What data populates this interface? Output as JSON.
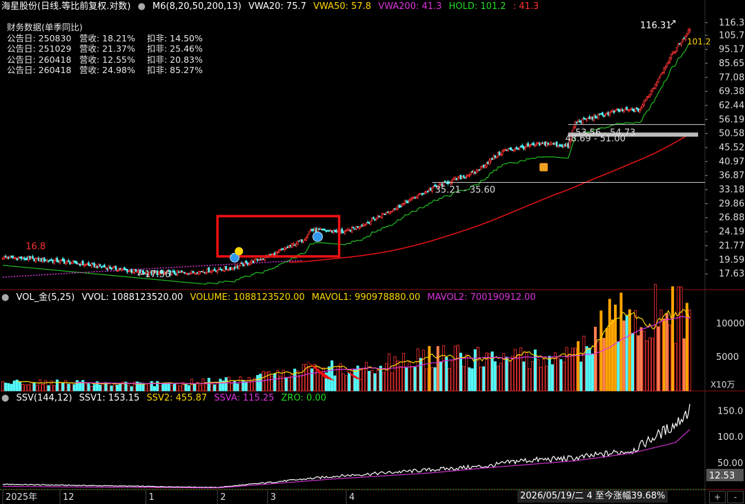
{
  "header": {
    "stock_name": "海星股份(日线.等比前复权.对数)",
    "indicator": "M6(8,20,50,200,13)",
    "vwa20": "VWA20: 75.7",
    "vwa50": "VWA50: 57.8",
    "vwa200": "VWA200: 41.3",
    "hold_label": "HOLD: 101.2",
    "hold_value": ": 41.3"
  },
  "financials": {
    "title": "财务数据(单季同比)",
    "rows": [
      {
        "date": "公告日: 250830",
        "rev": "营收: 18.21%",
        "np": "扣非: 14.50%"
      },
      {
        "date": "公告日: 251029",
        "rev": "营收: 21.37%",
        "np": "扣非: 25.46%"
      },
      {
        "date": "公告日: 260418",
        "rev": "营收: 12.55%",
        "np": "扣非: 20.83%"
      },
      {
        "date": "公告日: 260418",
        "rev": "营收: 24.98%",
        "np": "扣非: 85.27%"
      }
    ]
  },
  "vol_header": {
    "name": "VOL_金(5,25)",
    "vvol": "VVOL: 1088123520.00",
    "volume": "VOLUME: 1088123520.00",
    "mavol1": "MAVOL1: 990978880.00",
    "mavol2": "MAVOL2: 700190912.00"
  },
  "ssv_header": {
    "name": "SSV(144,12)",
    "ssv1": "SSV1: 153.15",
    "ssv2": "SSV2: 455.87",
    "ssva": "SSVA: 115.25",
    "zro": "ZRO: 0.00"
  },
  "annotations": {
    "high": "16.8",
    "low": "17.56",
    "peak": "116.31",
    "hold_line": "101.2",
    "zone1": "35.21 - 35.60",
    "zone2": "53.56 - 54.73",
    "zone3": "48.69 - 51.00",
    "ssv_current": "12.53"
  },
  "status_bar": {
    "selection": "2026/05/19/二 4 至今涨幅39.68%",
    "plus": "+",
    "minus": "-"
  },
  "colors": {
    "up": "#ff3333",
    "down": "#54fcfc",
    "hold_line": "#22bb22",
    "vwa200": "#dd1111",
    "dotted": "#cc33cc",
    "mavol1": "#ffd700",
    "mavol2": "#dd33dd",
    "ssv1": "#ffffff",
    "ssva": "#cc33cc",
    "box": "#ee1111"
  },
  "chart_data": [
    {
      "type": "candlestick",
      "title": "海星股份(日线.等比前复权.对数)",
      "yscale": "log",
      "ylim": [
        16.5,
        118
      ],
      "y_ticks": [
        "116.3",
        "105.7",
        "95.17",
        "85.65",
        "77.08",
        "69.38",
        "62.44",
        "56.19",
        "50.58",
        "45.52",
        "40.97",
        "36.87",
        "33.18",
        "29.86",
        "26.88",
        "24.19",
        "21.77",
        "19.59",
        "17.63"
      ],
      "x_labels": [
        "2025年",
        "12",
        "1",
        "2",
        "3",
        "4"
      ],
      "close_path": [
        [
          0,
          20.0
        ],
        [
          40,
          19.4
        ],
        [
          70,
          18.6
        ],
        [
          100,
          17.7
        ],
        [
          130,
          17.8
        ],
        [
          160,
          18.4
        ],
        [
          190,
          20.4
        ],
        [
          210,
          22.8
        ],
        [
          215,
          24.5
        ],
        [
          240,
          24.2
        ],
        [
          255,
          26.0
        ],
        [
          275,
          29.0
        ],
        [
          300,
          33.5
        ],
        [
          330,
          37.8
        ],
        [
          350,
          44.5
        ],
        [
          380,
          47.0
        ],
        [
          395,
          46.0
        ],
        [
          400,
          55.0
        ],
        [
          430,
          60.0
        ],
        [
          445,
          60.5
        ],
        [
          455,
          72.0
        ],
        [
          470,
          95.0
        ],
        [
          480,
          110.0
        ]
      ],
      "annotations": [
        "16.8",
        "17.56",
        "116.31",
        "101.2",
        "35.21 - 35.60",
        "53.56 - 54.73",
        "48.69 - 51.00"
      ]
    },
    {
      "type": "bar",
      "title": "VOL_金(5,25)",
      "ylim": [
        0,
        12500
      ],
      "y_ticks": [
        "10000",
        "5000"
      ],
      "unit": "X10万",
      "volume_path": [
        [
          0,
          1300
        ],
        [
          100,
          1000
        ],
        [
          170,
          1600
        ],
        [
          205,
          3200
        ],
        [
          260,
          3600
        ],
        [
          300,
          5000
        ],
        [
          350,
          4800
        ],
        [
          400,
          5200
        ],
        [
          430,
          11000
        ],
        [
          470,
          11500
        ]
      ],
      "series": [
        {
          "name": "MAVOL1"
        },
        {
          "name": "MAVOL2"
        }
      ]
    },
    {
      "type": "line",
      "title": "SSV(144,12)",
      "ylim": [
        0,
        165
      ],
      "y_ticks": [
        "150.0",
        "100.0",
        "50.00"
      ],
      "series": [
        {
          "name": "SSV1",
          "points": [
            [
              0,
              10
            ],
            [
              150,
              4
            ],
            [
              230,
              25
            ],
            [
              300,
              38
            ],
            [
              340,
              45
            ],
            [
              360,
              55
            ],
            [
              400,
              60
            ],
            [
              440,
              75
            ],
            [
              470,
              125
            ],
            [
              480,
              153
            ]
          ]
        },
        {
          "name": "SSVA",
          "points": [
            [
              0,
              6
            ],
            [
              150,
              3
            ],
            [
              230,
              20
            ],
            [
              300,
              32
            ],
            [
              340,
              42
            ],
            [
              400,
              55
            ],
            [
              440,
              70
            ],
            [
              470,
              90
            ],
            [
              480,
              115
            ]
          ]
        }
      ]
    }
  ]
}
